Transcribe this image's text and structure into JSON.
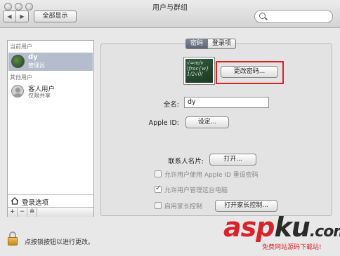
{
  "window": {
    "title": "用户与群组"
  },
  "toolbar": {
    "back": "◀",
    "forward": "▶",
    "show_all": "全部显示",
    "search_placeholder": ""
  },
  "sidebar": {
    "current_users_header": "当前用户",
    "current_user": {
      "name": "dy",
      "role": "管理员"
    },
    "other_users_header": "其他用户",
    "guest_user": {
      "name": "客人用户",
      "subtitle": "仅限共享"
    },
    "login_options": "登录选项",
    "add": "+",
    "remove": "−",
    "gear": "✲"
  },
  "tabs": {
    "password": "密码",
    "login_items": "登录项"
  },
  "photo_text": [
    "√=m/v",
    "\\frac{w}",
    "1/2√0/"
  ],
  "buttons": {
    "change_password": "更改密码...",
    "set_apple_id": "设定...",
    "open_contact": "打开...",
    "open_parental": "打开家长控制..."
  },
  "form": {
    "fullname_label": "全名:",
    "fullname_value": "dy",
    "appleid_label": "Apple ID:",
    "contact_label": "联系人名片:",
    "allow_reset": "允许用户使用 Apple ID 重设密码",
    "allow_admin": "允许用户管理这台电脑",
    "parental": "启用家长控制"
  },
  "footer": {
    "lock_text": "点按锁按钮以进行更改。"
  },
  "watermark": {
    "brand_a": "asp",
    "brand_b": "ku",
    "tld": ".com",
    "sub": "免费网站源码下载站!"
  }
}
